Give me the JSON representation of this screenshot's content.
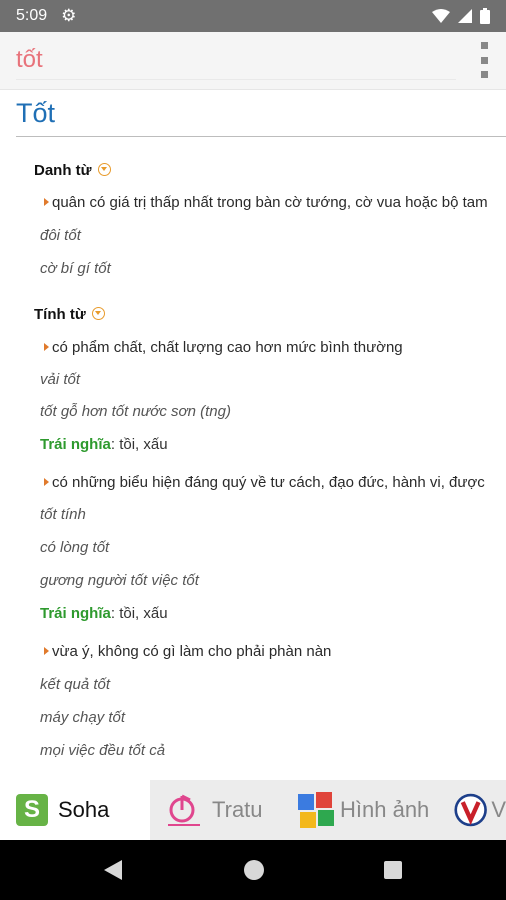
{
  "status": {
    "time": "5:09"
  },
  "header": {
    "search_value": "tốt"
  },
  "entry": {
    "title": "Tốt",
    "sections": [
      {
        "pos": "Danh từ",
        "senses": [
          {
            "definition": "quân có giá trị thấp nhất trong bàn cờ tướng, cờ vua hoặc bộ tam",
            "examples": [
              "đôi tốt",
              "cờ bí gí tốt"
            ]
          }
        ]
      },
      {
        "pos": "Tính từ",
        "senses": [
          {
            "definition": "có phẩm chất, chất lượng cao hơn mức bình thường",
            "examples": [
              "vải tốt",
              "tốt gỗ hơn tốt nước sơn (tng)"
            ],
            "antonym_label": "Trái nghĩa",
            "antonym_values": ": tồi, xấu"
          },
          {
            "definition": "có những biểu hiện đáng quý về tư cách, đạo đức, hành vi, được",
            "examples": [
              "tốt tính",
              "có lòng tốt",
              "gương người tốt việc tốt"
            ],
            "antonym_label": "Trái nghĩa",
            "antonym_values": ": tồi, xấu"
          },
          {
            "definition": "vừa ý, không có gì làm cho phải phàn nàn",
            "examples": [
              "kết quả tốt",
              "máy chạy tốt",
              "mọi việc đều tốt cả"
            ]
          }
        ]
      }
    ]
  },
  "tabs": [
    {
      "label": "Soha",
      "icon_text": "S",
      "active": true
    },
    {
      "label": "Tratu",
      "active": false
    },
    {
      "label": "Hình ảnh",
      "active": false
    },
    {
      "label": "V",
      "active": false
    }
  ],
  "colors": {
    "accent": "#1f6fb5",
    "search_text": "#e8737b",
    "antonym": "#2e9a2e",
    "soha_green": "#67b346"
  }
}
